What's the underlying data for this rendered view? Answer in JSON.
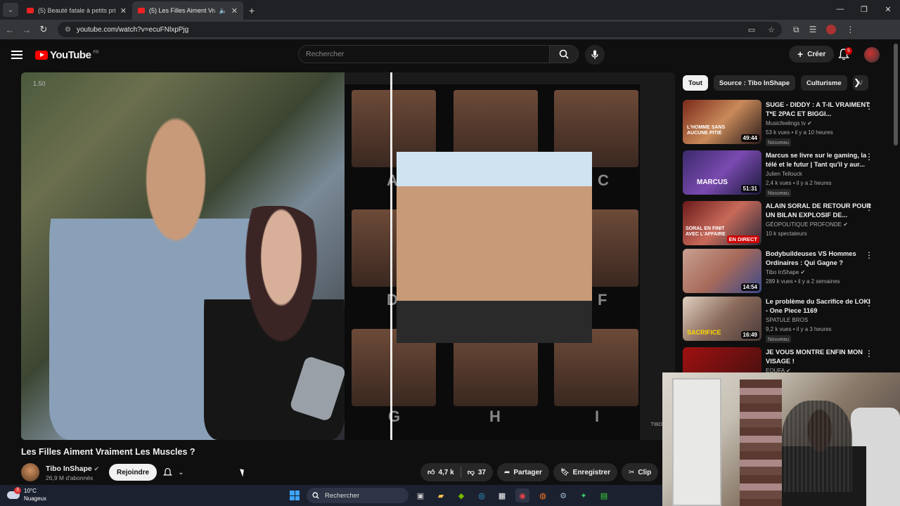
{
  "browser": {
    "tabs": [
      {
        "label": "(5) Beauté fatale à petits prix | ",
        "active": false
      },
      {
        "label": "(5) Les Filles Aiment Vraime",
        "active": true
      }
    ],
    "url": "youtube.com/watch?v=ecuFNlxpPjg"
  },
  "header": {
    "logo_text": "YouTube",
    "country_code": "FR",
    "search_placeholder": "Rechercher",
    "create_label": "Créer",
    "notif_count": "5"
  },
  "video": {
    "timecode": "1.50",
    "grid_letters": [
      "A",
      "C",
      "D",
      "F",
      "G",
      "H",
      "I"
    ],
    "title": "Les Filles Aiment Vraiment Les Muscles ?",
    "channel": "Tibo InShape",
    "subscribers": "26,9 M d'abonnés",
    "join_label": "Rejoindre",
    "likes": "4,7 k",
    "dislikes": "37",
    "share_label": "Partager",
    "save_label": "Enregistrer",
    "clip_label": "Clip"
  },
  "chips": [
    "Tout",
    "Source : Tibo InShape",
    "Culturisme",
    "V"
  ],
  "recommendations": [
    {
      "title": "SUGE - DIDDY : A T-IL VRAIMENT T*E 2PAC ET BIGGI...",
      "channel": "Musicfeelings tv",
      "meta": "53 k vues • il y a 10 heures",
      "badge": "Nouveau",
      "duration": "49:44",
      "verified": true,
      "overlay": "L'HOMME SANS AUCUNE PITIÉ"
    },
    {
      "title": "Marcus se livre sur le gaming, la télé et le futur | Tant qu'il y aur...",
      "channel": "Julien Tellouck",
      "meta": "2,4 k vues • il y a 2 heures",
      "badge": "Nouveau",
      "duration": "51:31",
      "verified": false,
      "overlay": "MARCUS"
    },
    {
      "title": "ALAIN SORAL DE RETOUR POUR UN BILAN EXPLOSIF DE...",
      "channel": "GÉOPOLITIQUE PROFONDE",
      "meta": "10 k spectateurs",
      "badge": "",
      "duration": "EN DIRECT",
      "verified": true,
      "overlay": "SORAL EN FINIT AVEC L'AFFAIRE"
    },
    {
      "title": "Bodybuildeuses VS Hommes Ordinaires : Qui Gagne ?",
      "channel": "Tibo InShape",
      "meta": "289 k vues • il y a 2 semaines",
      "badge": "",
      "duration": "14:54",
      "verified": true,
      "overlay": ""
    },
    {
      "title": "Le problème du Sacrifice de LOKI - One Piece 1169",
      "channel": "SPATULE BROS",
      "meta": "9,2 k vues • il y a 3 heures",
      "badge": "Nouveau",
      "duration": "16:49",
      "verified": false,
      "overlay": "SACRIFICE"
    },
    {
      "title": "JE VOUS MONTRE ENFIN MON VISAGE !",
      "channel": "EQUFA",
      "meta": "",
      "badge": "",
      "duration": "",
      "verified": true,
      "overlay": ""
    }
  ],
  "taskbar": {
    "temperature": "10°C",
    "weather": "Nuageux",
    "weather_badge": "3",
    "search_label": "Rechercher"
  },
  "colors": {
    "accent": "#ff0000",
    "background": "#0f0f0f",
    "chip_bg": "#272727"
  }
}
